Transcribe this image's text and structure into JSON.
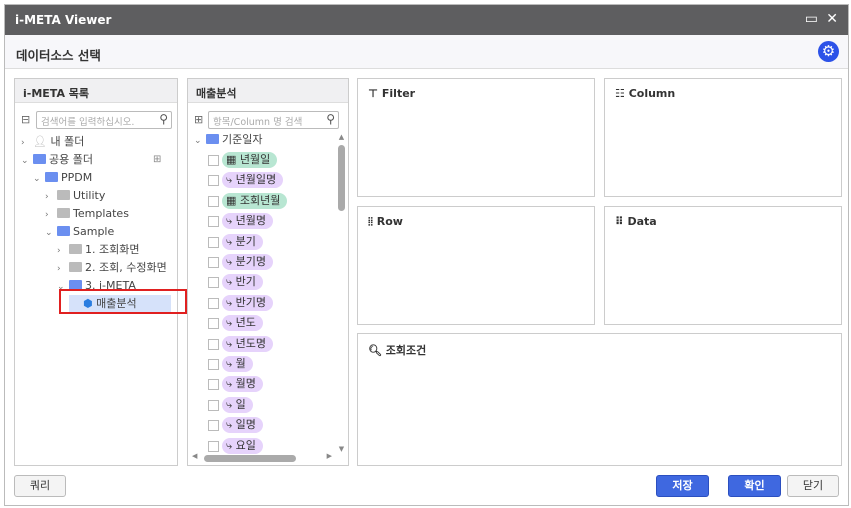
{
  "window": {
    "title": "i-META Viewer",
    "maximize_icon": "▭",
    "close_icon": "✕"
  },
  "header": {
    "title": "데이터소스 선택"
  },
  "left_panel": {
    "title": "i-META 목록",
    "search_placeholder": "검색어를 입력하십시오.",
    "tree": [
      {
        "label": "내 폴더",
        "depth": 0,
        "expanded": false,
        "kind": "user"
      },
      {
        "label": "공용 폴더",
        "depth": 0,
        "expanded": true,
        "kind": "blue"
      },
      {
        "label": "PPDM",
        "depth": 1,
        "expanded": true,
        "kind": "blue"
      },
      {
        "label": "Utility",
        "depth": 2,
        "expanded": false,
        "kind": "gray"
      },
      {
        "label": "Templates",
        "depth": 2,
        "expanded": false,
        "kind": "gray"
      },
      {
        "label": "Sample",
        "depth": 2,
        "expanded": true,
        "kind": "blue"
      },
      {
        "label": "1. 조회화면",
        "depth": 3,
        "expanded": false,
        "kind": "gray"
      },
      {
        "label": "2. 조회, 수정화면",
        "depth": 3,
        "expanded": false,
        "kind": "gray"
      },
      {
        "label": "3. i-META",
        "depth": 3,
        "expanded": true,
        "kind": "blue"
      },
      {
        "label": "매출분석",
        "depth": 4,
        "kind": "meta",
        "selected": true
      }
    ]
  },
  "middle_panel": {
    "title": "매출분석",
    "search_placeholder": "항목/Column 명 검색",
    "group": "기준일자",
    "items": [
      {
        "label": "년월일",
        "type": "date"
      },
      {
        "label": "년월일명",
        "type": "dim"
      },
      {
        "label": "조회년월",
        "type": "date"
      },
      {
        "label": "년월명",
        "type": "dim"
      },
      {
        "label": "분기",
        "type": "dim"
      },
      {
        "label": "분기명",
        "type": "dim"
      },
      {
        "label": "반기",
        "type": "dim"
      },
      {
        "label": "반기명",
        "type": "dim"
      },
      {
        "label": "년도",
        "type": "dim"
      },
      {
        "label": "년도명",
        "type": "dim"
      },
      {
        "label": "월",
        "type": "dim"
      },
      {
        "label": "월명",
        "type": "dim"
      },
      {
        "label": "일",
        "type": "dim"
      },
      {
        "label": "일명",
        "type": "dim"
      },
      {
        "label": "요일",
        "type": "dim"
      }
    ]
  },
  "zones": {
    "filter": "Filter",
    "column": "Column",
    "row": "Row",
    "data": "Data",
    "condition": "조회조건"
  },
  "buttons": {
    "query": "쿼리",
    "save": "저장",
    "ok": "확인",
    "close": "닫기"
  },
  "colors": {
    "accent": "#3f68e0",
    "titlebar": "#5e5e60",
    "date_pill": "#b8e6d2",
    "dim_pill": "#e6d3fb"
  }
}
